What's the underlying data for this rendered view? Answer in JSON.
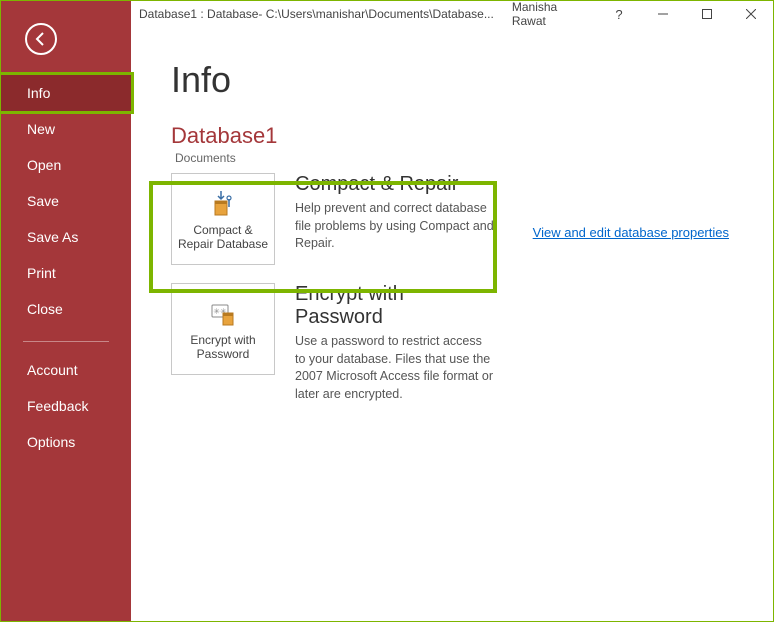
{
  "titlebar": {
    "title": "Database1 : Database- C:\\Users\\manishar\\Documents\\Database...",
    "username": "Manisha Rawat"
  },
  "sidebar": {
    "items": [
      {
        "label": "Info",
        "selected": true
      },
      {
        "label": "New"
      },
      {
        "label": "Open"
      },
      {
        "label": "Save"
      },
      {
        "label": "Save As"
      },
      {
        "label": "Print"
      },
      {
        "label": "Close"
      }
    ],
    "footer": [
      {
        "label": "Account"
      },
      {
        "label": "Feedback"
      },
      {
        "label": "Options"
      }
    ]
  },
  "page": {
    "heading": "Info",
    "database_name": "Database1",
    "path_label": "Documents",
    "properties_link": "View and edit database properties"
  },
  "actions": {
    "compact": {
      "tile_label": "Compact & Repair Database",
      "title": "Compact & Repair",
      "description": "Help prevent and correct database file problems by using Compact and Repair."
    },
    "encrypt": {
      "tile_label": "Encrypt with Password",
      "title": "Encrypt with Password",
      "description": "Use a password to restrict access to your database. Files that use the 2007 Microsoft Access file format or later are encrypted."
    }
  }
}
